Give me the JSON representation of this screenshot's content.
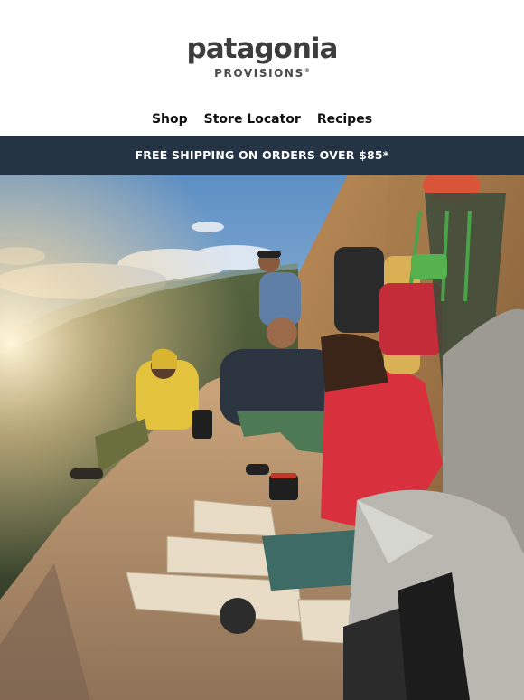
{
  "brand": {
    "name": "patagonia",
    "sub": "PROVISIONS",
    "mark": "®"
  },
  "nav": {
    "items": [
      {
        "label": "Shop"
      },
      {
        "label": "Store Locator"
      },
      {
        "label": "Recipes"
      }
    ]
  },
  "banner": {
    "text": "FREE SHIPPING ON ORDERS OVER $85*"
  },
  "hero": {
    "subject": "climbers-on-cliff-ledge-photo"
  },
  "colors": {
    "banner_bg": "#243444",
    "logo_text": "#3d3d3d"
  }
}
